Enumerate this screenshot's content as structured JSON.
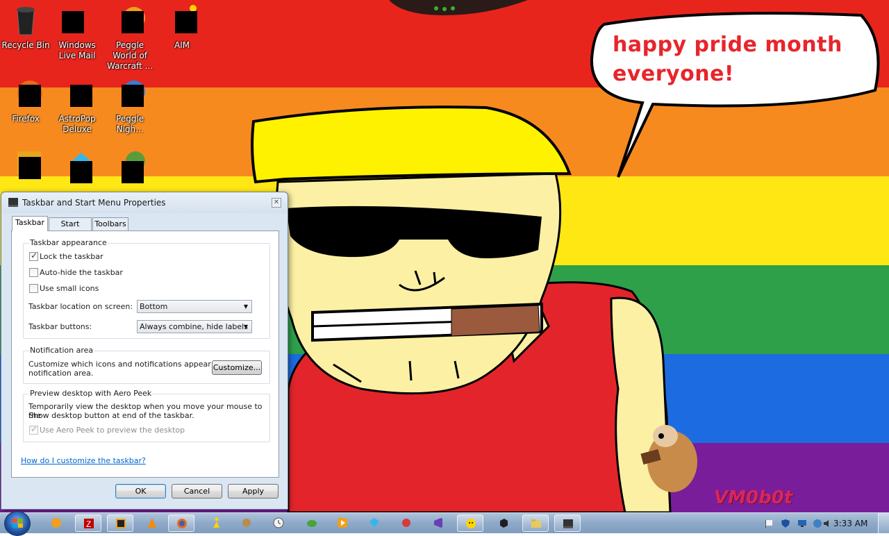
{
  "wallpaper": {
    "speech_bubble_text": "happy pride month everyone!",
    "signature": "VM0b0t",
    "stripe_colors": [
      "#e8251d",
      "#f68a1f",
      "#ffe714",
      "#2ea04a",
      "#1d6be0",
      "#7a1d9a"
    ]
  },
  "desktop_icons": [
    {
      "label": "Recycle Bin",
      "icon": "recycle-bin-icon"
    },
    {
      "label": "Windows Live Mail",
      "icon": "mail-icon"
    },
    {
      "label": "Peggle World of Warcraft ...",
      "icon": "peggle-icon"
    },
    {
      "label": "AIM",
      "icon": "aim-icon"
    },
    {
      "label": "Firefox",
      "icon": "firefox-icon"
    },
    {
      "label": "AstroPop Deluxe",
      "icon": "astropop-icon"
    },
    {
      "label": "Peggle Nigh...",
      "icon": "peggle-nights-icon"
    },
    {
      "label": "",
      "icon": "app-icon"
    },
    {
      "label": "",
      "icon": "gem-icon"
    },
    {
      "label": "",
      "icon": "plant-icon"
    }
  ],
  "dialog": {
    "title": "Taskbar and Start Menu Properties",
    "close_label": "✕",
    "tabs": [
      "Taskbar",
      "Start Menu",
      "Toolbars"
    ],
    "appearance": {
      "legend": "Taskbar appearance",
      "lock_label": "Lock the taskbar",
      "lock_checked": true,
      "autohide_label": "Auto-hide the taskbar",
      "autohide_checked": false,
      "small_icons_label": "Use small icons",
      "small_icons_checked": false,
      "location_label": "Taskbar location on screen:",
      "location_value": "Bottom",
      "buttons_label": "Taskbar buttons:",
      "buttons_value": "Always combine, hide labels"
    },
    "notification": {
      "legend": "Notification area",
      "description_line1": "Customize which icons and notifications appear in the",
      "description_line2": "notification area.",
      "customize_button": "Customize..."
    },
    "aero_peek": {
      "legend": "Preview desktop with Aero Peek",
      "description_line1": "Temporarily view the desktop when you move your mouse to the",
      "description_line2": "Show desktop button at end of the taskbar.",
      "checkbox_label": "Use Aero Peek to preview the desktop",
      "checkbox_checked": true,
      "checkbox_disabled": true
    },
    "help_link": "How do I customize the taskbar?",
    "ok_button": "OK",
    "cancel_button": "Cancel",
    "apply_button": "Apply"
  },
  "taskbar": {
    "pinned": [
      {
        "name": "peggle",
        "icon": "peggle-icon"
      },
      {
        "name": "filezilla",
        "icon": "filezilla-icon"
      },
      {
        "name": "dreamweaver",
        "icon": "app-icon"
      },
      {
        "name": "vlc",
        "icon": "vlc-icon"
      },
      {
        "name": "firefox",
        "icon": "firefox-icon"
      },
      {
        "name": "aim",
        "icon": "aim-icon"
      },
      {
        "name": "game",
        "icon": "game-icon"
      },
      {
        "name": "clock",
        "icon": "clock-icon"
      },
      {
        "name": "frog",
        "icon": "frog-icon"
      },
      {
        "name": "media-player",
        "icon": "media-player-icon"
      },
      {
        "name": "gem",
        "icon": "gem-icon"
      },
      {
        "name": "parrot",
        "icon": "parrot-icon"
      },
      {
        "name": "visual-studio",
        "icon": "visual-studio-icon"
      },
      {
        "name": "yahoo-messenger",
        "icon": "messenger-icon"
      },
      {
        "name": "cube",
        "icon": "cube-icon"
      },
      {
        "name": "file-manager",
        "icon": "folder-icon"
      },
      {
        "name": "taskbar-properties",
        "icon": "taskbar-properties-icon"
      }
    ],
    "clock": "3:33 AM",
    "tray_icons": [
      "flag-icon",
      "shield-icon",
      "monitor-icon",
      "network-icon",
      "volume-icon"
    ]
  }
}
